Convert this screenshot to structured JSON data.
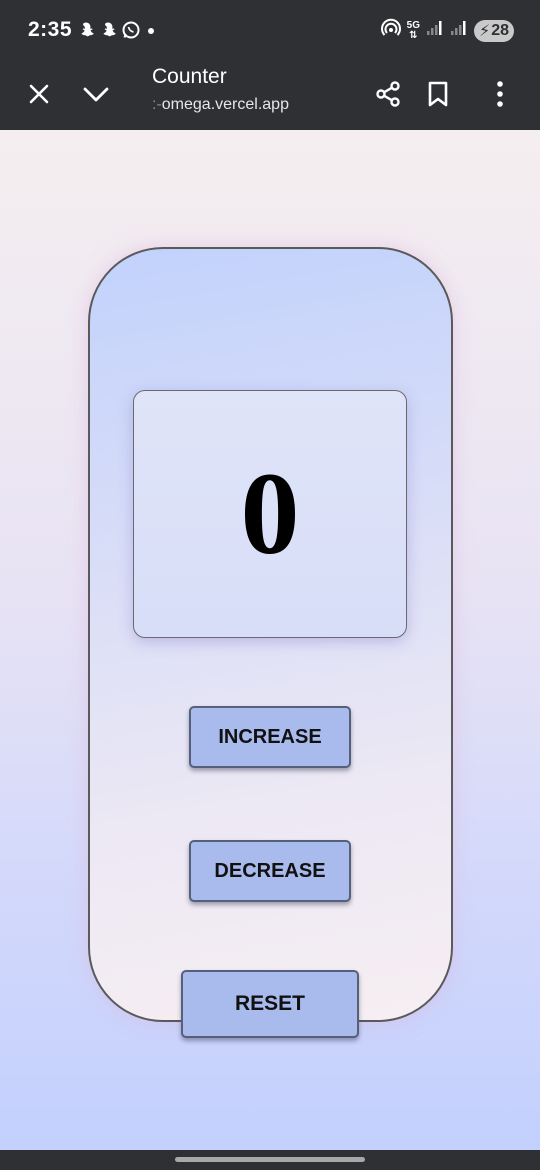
{
  "status_bar": {
    "time": "2:35",
    "network": "5G",
    "battery": "28",
    "icons": [
      "snapchat-icon",
      "snapchat-icon",
      "whatsapp-icon",
      "dot-icon",
      "hotspot-icon",
      "signal-icon",
      "signal-icon",
      "battery-charging-icon"
    ]
  },
  "browser": {
    "page_title": "Counter",
    "url_prefix": ":-",
    "url": "omega.vercel.app",
    "icons": [
      "close-icon",
      "chevron-down-icon",
      "share-icon",
      "bookmark-icon",
      "more-vert-icon"
    ]
  },
  "counter": {
    "value": "0",
    "increase_label": "INCREASE",
    "decrease_label": "DECREASE",
    "reset_label": "RESET"
  },
  "colors": {
    "chrome_bg": "#2f3033",
    "button_bg": "#a9bbec",
    "card_border": "#5a5a5a"
  }
}
